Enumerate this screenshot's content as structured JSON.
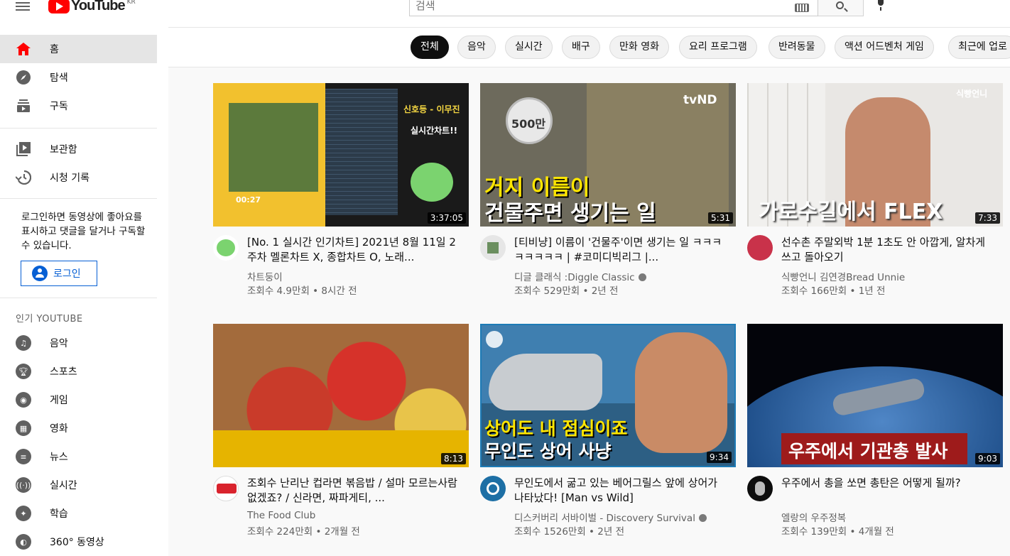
{
  "header": {
    "logo_text": "YouTube",
    "logo_region": "KR",
    "search_placeholder": "검색"
  },
  "sidebar": {
    "main_items": [
      {
        "label": "홈",
        "icon": "home-icon"
      },
      {
        "label": "탐색",
        "icon": "compass-icon"
      },
      {
        "label": "구독",
        "icon": "subscriptions-icon"
      }
    ],
    "library_items": [
      {
        "label": "보관함",
        "icon": "library-icon"
      },
      {
        "label": "시청 기록",
        "icon": "history-icon"
      }
    ],
    "login_note": "로그인하면 동영상에 좋아요를 표시하고 댓글을 달거나 구독할 수 있습니다.",
    "login_button": "로그인",
    "section_title": "인기 YOUTUBE",
    "categories": [
      {
        "label": "음악",
        "icon": "music-icon"
      },
      {
        "label": "스포츠",
        "icon": "trophy-icon"
      },
      {
        "label": "게임",
        "icon": "gamepad-icon"
      },
      {
        "label": "영화",
        "icon": "film-icon"
      },
      {
        "label": "뉴스",
        "icon": "news-icon"
      },
      {
        "label": "실시간",
        "icon": "live-icon"
      },
      {
        "label": "학습",
        "icon": "lightbulb-icon"
      },
      {
        "label": "360° 동영상",
        "icon": "vr-icon"
      }
    ]
  },
  "chips": [
    "전체",
    "음악",
    "실시간",
    "배구",
    "만화 영화",
    "요리 프로그램",
    "반려동물",
    "액션 어드벤처 게임",
    "최근에 업로"
  ],
  "videos": [
    {
      "title": "[No. 1 실시간 인기차트] 2021년 8월 11일 2주차 멜론차트 X, 종합차트 O, 노래...",
      "channel": "차트둥이",
      "meta": "조회수 4.9만회 • 8시간 전",
      "duration": "3:37:05",
      "verified": false,
      "thumb_text": [
        "신호등 - 이무진",
        "실시간차트!!",
        "00:27"
      ]
    },
    {
      "title": "[티비냥] 이름이 '건물주'이면 생기는 일 ㅋㅋㅋㅋㅋㅋㅋㅋ | #코미디빅리그 |...",
      "channel": "디글 클래식 :Diggle Classic",
      "meta": "조회수 529만회 • 2년 전",
      "duration": "5:31",
      "verified": true,
      "thumb_text": [
        "거지 이름이",
        "건물주면 생기는 일",
        "500만",
        "tvND"
      ]
    },
    {
      "title": "선수촌 주말외박 1분 1초도 안 아깝게, 알차게 쓰고 돌아오기",
      "channel": "식빵언니 김연경Bread Unnie",
      "meta": "조회수 166만회 • 1년 전",
      "duration": "7:33",
      "verified": false,
      "thumb_text": [
        "가로수길에서 FLEX",
        "식빵언니"
      ]
    },
    {
      "title": "조회수 난리난 컵라면 볶음밥 / 설마 모르는사람 없겠죠? / 신라면, 짜파게티, ...",
      "channel": "The Food Club",
      "meta": "조회수 224만회 • 2개월 전",
      "duration": "8:13",
      "verified": false,
      "thumb_text": []
    },
    {
      "title": "무인도에서 굶고 있는 베어그릴스 앞에 상어가 나타났다! [Man vs Wild]",
      "channel": "디스커버리 서바이벌 - Discovery Survival",
      "meta": "조회수 1526만회 • 2년 전",
      "duration": "9:34",
      "verified": true,
      "thumb_text": [
        "상어도 내 점심이죠",
        "무인도 상어 사냥"
      ]
    },
    {
      "title": "우주에서 총을 쏘면 총탄은 어떻게 될까?",
      "channel": "엘랑의 우주정복",
      "meta": "조회수 139만회 • 4개월 전",
      "duration": "9:03",
      "verified": false,
      "thumb_text": [
        "우주에서 기관총 발사"
      ]
    }
  ],
  "colors": {
    "brand_red": "#ff0000",
    "link_blue": "#065fd4",
    "active_chip": "#0f0f0f"
  }
}
